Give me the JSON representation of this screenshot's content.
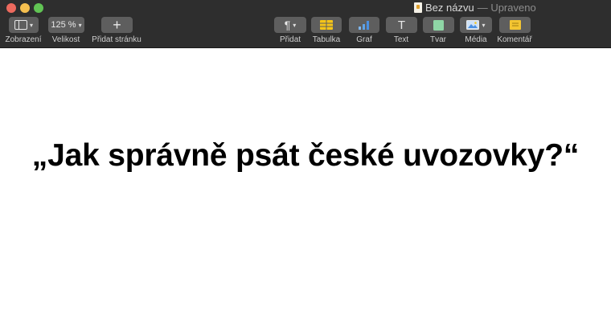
{
  "window": {
    "title": "Bez názvu",
    "status": "— Upraveno"
  },
  "toolbar": {
    "zoom_value": "125 %",
    "add_symbol": "+",
    "text_symbol": "T",
    "paragraph_symbol": "¶",
    "labels": {
      "view": "Zobrazení",
      "zoom": "Velikost",
      "add_page": "Přidat stránku",
      "insert": "Přidat",
      "table": "Tabulka",
      "chart": "Graf",
      "text": "Text",
      "shape": "Tvar",
      "media": "Média",
      "comment": "Komentář"
    },
    "colors": {
      "table_icon": "#f5c518",
      "chart_icon": "#4a90e2",
      "shape_icon": "#8fd6a6",
      "comment_icon": "#f3c532"
    }
  },
  "document": {
    "headline": "„Jak správně psát české uvozovky?“"
  }
}
